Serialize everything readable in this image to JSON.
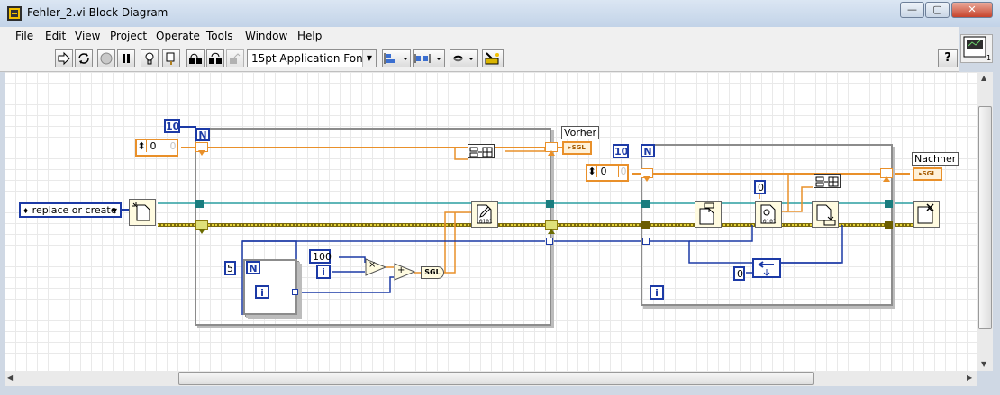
{
  "window": {
    "title": "Fehler_2.vi Block Diagram",
    "minimize": "—",
    "maximize": "▢",
    "close": "✕"
  },
  "menu": [
    "File",
    "Edit",
    "View",
    "Project",
    "Operate",
    "Tools",
    "Window",
    "Help"
  ],
  "toolbar": {
    "font_select": "15pt Application Font",
    "help_glyph": "?"
  },
  "diagram": {
    "enum_value": "replace or create",
    "left_loop_count": "10",
    "left_shift_init": "0",
    "left_shift_init_b": "0",
    "inner_loop_count": "5",
    "constant_100": "100",
    "iteration_terminal": "i",
    "multiply_glyph": "×",
    "add_glyph": "+",
    "sgl_label": "SGL",
    "vorher_label": "Vorher",
    "right_loop_count": "10",
    "right_shift_init": "0",
    "right_shift_init_b": "0",
    "const_zero_top": "0",
    "const_zero_bottom": "0",
    "nachher_label": "Nachher",
    "n_terminal": "N",
    "indicator_sgl": "SGL",
    "right_iteration": "i"
  },
  "colors": {
    "wire_orange": "#e9902a",
    "wire_blue": "#1c3aa6",
    "wire_teal": "#2a9ea0",
    "wire_error": "#b8a41c",
    "loop_border": "#8c8c8c"
  }
}
